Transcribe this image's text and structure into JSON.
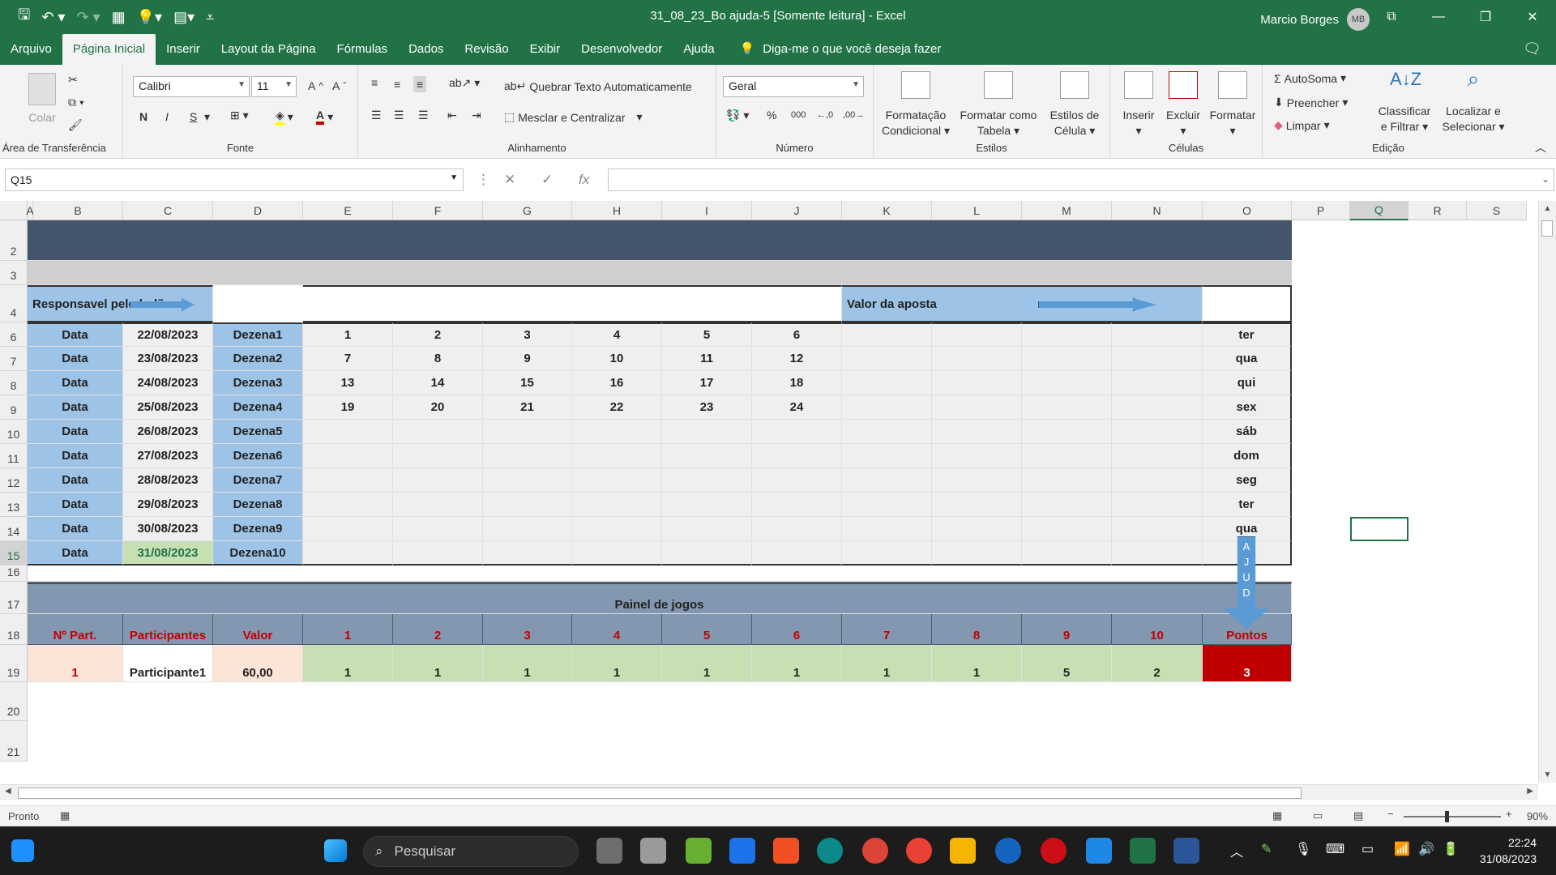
{
  "window": {
    "title": "31_08_23_Bo ajuda-5  [Somente leitura]  -  Excel",
    "user": "Marcio Borges",
    "user_initials": "MB"
  },
  "tabs": [
    "Arquivo",
    "Página Inicial",
    "Inserir",
    "Layout da Página",
    "Fórmulas",
    "Dados",
    "Revisão",
    "Exibir",
    "Desenvolvedor",
    "Ajuda"
  ],
  "tell_me": "Diga-me o que você deseja fazer",
  "ribbon": {
    "clipboard": {
      "label": "Área de Transferência",
      "paste": "Colar"
    },
    "font": {
      "label": "Fonte",
      "name": "Calibri",
      "size": "11",
      "bold": "N",
      "italic": "I",
      "underline": "S"
    },
    "alignment": {
      "label": "Alinhamento",
      "wrap": "Quebrar Texto Automaticamente",
      "merge": "Mesclar e Centralizar"
    },
    "number": {
      "label": "Número",
      "format": "Geral",
      "percent": "%",
      "thousands": "000"
    },
    "styles": {
      "label": "Estilos",
      "cond1": "Formatação",
      "cond2": "Condicional",
      "table1": "Formatar como",
      "table2": "Tabela",
      "cell1": "Estilos de",
      "cell2": "Célula"
    },
    "cells": {
      "label": "Células",
      "insert": "Inserir",
      "delete": "Excluir",
      "format": "Formatar"
    },
    "editing": {
      "label": "Edição",
      "autosum": "AutoSoma",
      "fill": "Preencher",
      "clear": "Limpar",
      "sort1": "Classificar",
      "sort2": "e Filtrar",
      "find1": "Localizar e",
      "find2": "Selecionar"
    }
  },
  "formula_bar": {
    "name_box": "Q15",
    "fx": "fx",
    "content": ""
  },
  "columns": [
    "A",
    "B",
    "C",
    "D",
    "E",
    "F",
    "G",
    "H",
    "I",
    "J",
    "K",
    "L",
    "M",
    "N",
    "O",
    "P",
    "Q",
    "R",
    "S"
  ],
  "rows": [
    "2",
    "3",
    "4",
    "6",
    "7",
    "8",
    "9",
    "10",
    "11",
    "12",
    "13",
    "14",
    "15",
    "16",
    "17",
    "18",
    "19",
    "20",
    "21"
  ],
  "sheet": {
    "responsavel": "Responsavel pelo bolão",
    "valor_aposta": "Valor da aposta",
    "draws": [
      {
        "label": "Data",
        "date": "22/08/2023",
        "dezena": "Dezena1",
        "nums": [
          "1",
          "2",
          "3",
          "4",
          "5",
          "6"
        ],
        "day": "ter"
      },
      {
        "label": "Data",
        "date": "23/08/2023",
        "dezena": "Dezena2",
        "nums": [
          "7",
          "8",
          "9",
          "10",
          "11",
          "12"
        ],
        "day": "qua"
      },
      {
        "label": "Data",
        "date": "24/08/2023",
        "dezena": "Dezena3",
        "nums": [
          "13",
          "14",
          "15",
          "16",
          "17",
          "18"
        ],
        "day": "qui"
      },
      {
        "label": "Data",
        "date": "25/08/2023",
        "dezena": "Dezena4",
        "nums": [
          "19",
          "20",
          "21",
          "22",
          "23",
          "24"
        ],
        "day": "sex"
      },
      {
        "label": "Data",
        "date": "26/08/2023",
        "dezena": "Dezena5",
        "nums": [
          "",
          "",
          "",
          "",
          "",
          ""
        ],
        "day": "sáb"
      },
      {
        "label": "Data",
        "date": "27/08/2023",
        "dezena": "Dezena6",
        "nums": [
          "",
          "",
          "",
          "",
          "",
          ""
        ],
        "day": "dom"
      },
      {
        "label": "Data",
        "date": "28/08/2023",
        "dezena": "Dezena7",
        "nums": [
          "",
          "",
          "",
          "",
          "",
          ""
        ],
        "day": "seg"
      },
      {
        "label": "Data",
        "date": "29/08/2023",
        "dezena": "Dezena8",
        "nums": [
          "",
          "",
          "",
          "",
          "",
          ""
        ],
        "day": "ter"
      },
      {
        "label": "Data",
        "date": "30/08/2023",
        "dezena": "Dezena9",
        "nums": [
          "",
          "",
          "",
          "",
          "",
          ""
        ],
        "day": "qua"
      },
      {
        "label": "Data",
        "date": "31/08/2023",
        "dezena": "Dezena10",
        "nums": [
          "",
          "",
          "",
          "",
          "",
          ""
        ],
        "day": ""
      }
    ],
    "painel_title": "Painel de jogos",
    "painel_headers": [
      "Nº Part.",
      "Participantes",
      "Valor",
      "1",
      "2",
      "3",
      "4",
      "5",
      "6",
      "7",
      "8",
      "9",
      "10",
      "Pontos"
    ],
    "participant_row": [
      "1",
      "Participante1",
      "60,00",
      "1",
      "1",
      "1",
      "1",
      "1",
      "1",
      "1",
      "1",
      "5",
      "2",
      "3"
    ],
    "callout_letters": [
      "A",
      "J",
      "U",
      "D"
    ]
  },
  "status": {
    "ready": "Pronto",
    "zoom": "90%"
  },
  "taskbar": {
    "search": "Pesquisar",
    "time": "22:24",
    "date": "31/08/2023"
  },
  "colors": {
    "excel_green": "#217346",
    "header_dark": "#44546a",
    "header_gray": "#d0cece",
    "blue_label": "#9dc3e6",
    "panel_blue": "#8497b0",
    "points_red": "#c00000"
  }
}
